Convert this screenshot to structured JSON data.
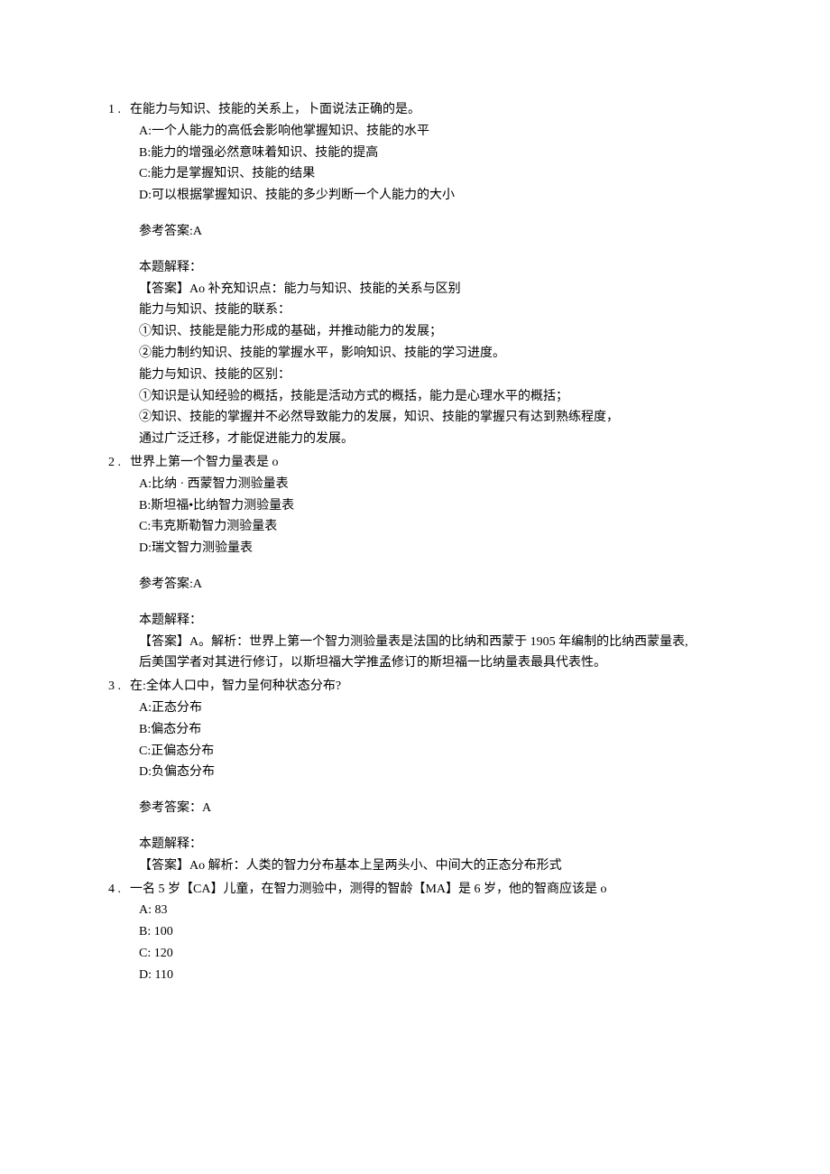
{
  "questions": [
    {
      "num": "1 .",
      "stem": "在能力与知识、技能的关系上，卜面说法正确的是。",
      "options": [
        "A:一个人能力的高低会影响他掌握知识、技能的水平",
        "B:能力的增强必然意味着知识、技能的提高",
        "C:能力是掌握知识、技能的结果",
        "D:可以根据掌握知识、技能的多少判断一个人能力的大小"
      ],
      "ref": "参考答案:A",
      "explain_label": "本题解释：",
      "explain_lines": [
        "【答案】Ao 补充知识点：能力与知识、技能的关系与区别",
        "能力与知识、技能的联系：",
        "①知识、技能是能力形成的基础，并推动能力的发展；",
        "②能力制约知识、技能的掌握水平，影响知识、技能的学习进度。",
        "能力与知识、技能的区别：",
        "①知识是认知经验的概括，技能是活动方式的概括，能力是心理水平的概括；",
        "②知识、技能的掌握并不必然导致能力的发展，知识、技能的掌握只有达到熟练程度，",
        "通过广泛迁移，才能促进能力的发展。"
      ]
    },
    {
      "num": "2 .",
      "stem": "世界上第一个智力量表是 o",
      "options": [
        "A:比纳 · 西蒙智力测验量表",
        "B:斯坦福•比纳智力测验量表",
        "C:韦克斯勒智力测验量表",
        "D:瑞文智力测验量表"
      ],
      "ref": "参考答案:A",
      "explain_label": "本题解释：",
      "explain_lines": [
        "【答案】A。解析：世界上第一个智力测验量表是法国的比纳和西蒙于 1905 年编制的比纳西蒙量表,",
        "后美国学者对其进行修订，以斯坦福大学推孟修订的斯坦福一比纳量表最具代表性。"
      ]
    },
    {
      "num": "3 .",
      "stem": "在:全体人口中，智力呈何种状态分布?",
      "options": [
        "A:正态分布",
        "B:偏态分布",
        "C:正偏态分布",
        "D:负偏态分布"
      ],
      "ref": "参考答案：A",
      "explain_label": "本题解释：",
      "explain_lines": [
        "【答案】Ao 解析：人类的智力分布基本上呈两头小、中间大的正态分布形式"
      ]
    },
    {
      "num": "4 .",
      "stem": "一名 5 岁【CA】儿童，在智力测验中，测得的智龄【MA】是 6 岁，他的智商应该是 o",
      "options": [
        "A:   83",
        "B:   100",
        "C:   120",
        "D:   110"
      ],
      "ref": null,
      "explain_label": null,
      "explain_lines": []
    }
  ]
}
